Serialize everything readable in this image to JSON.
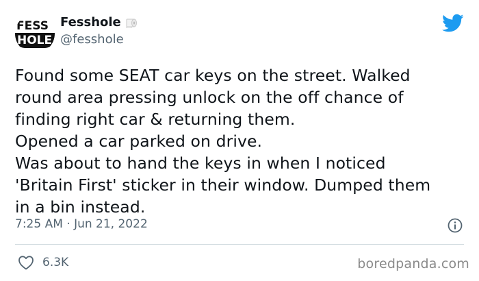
{
  "author": {
    "avatar_text_top": "FESS",
    "avatar_text_bottom": "HOLE",
    "display_name": "Fesshole",
    "handle": "@fesshole",
    "name_icon": "toilet-paper-icon"
  },
  "platform_icon": "twitter-bird-icon",
  "tweet": {
    "text": "Found some SEAT car keys on the street. Walked\nround area pressing unlock on the off chance of\nfinding right car & returning them.\nOpened a car parked on drive.\nWas about to hand the keys in when I noticed\n'Britain First' sticker in their window. Dumped them\nin a bin instead.",
    "timestamp": "7:25 AM · Jun 21, 2022",
    "likes": "6.3K"
  },
  "watermark": "boredpanda.com",
  "colors": {
    "twitter_blue": "#1d9bf0",
    "secondary_text": "#536471",
    "primary_text": "#0f1419",
    "divider": "#cfd9de"
  }
}
